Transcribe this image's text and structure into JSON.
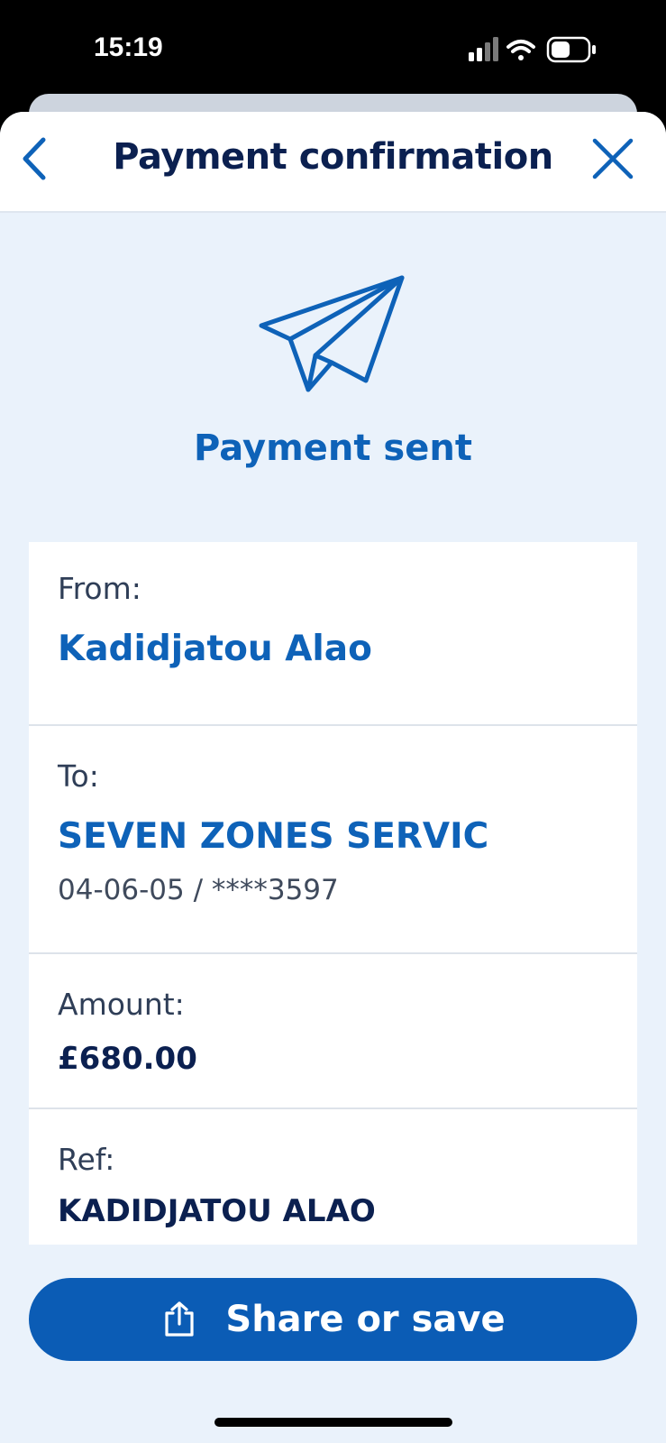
{
  "status_bar": {
    "time": "15:19"
  },
  "header": {
    "title": "Payment confirmation"
  },
  "hero": {
    "title": "Payment sent"
  },
  "details": {
    "from": {
      "label": "From:",
      "name": "Kadidjatou Alao"
    },
    "to": {
      "label": "To:",
      "name": "SEVEN ZONES SERVIC",
      "account": "04-06-05 / ****3597"
    },
    "amount": {
      "label": "Amount:",
      "value": "£680.00"
    },
    "ref": {
      "label": "Ref:",
      "value": "KADIDJATOU ALAO"
    }
  },
  "actions": {
    "share_label": "Share or save"
  },
  "icons": {
    "back": "chevron-left-icon",
    "close": "close-icon",
    "hero": "paper-plane-icon",
    "share": "share-icon"
  },
  "colors": {
    "accent": "#0e62b8",
    "navy": "#0b2050",
    "background": "#eaf2fb",
    "button": "#0b5cb5"
  }
}
